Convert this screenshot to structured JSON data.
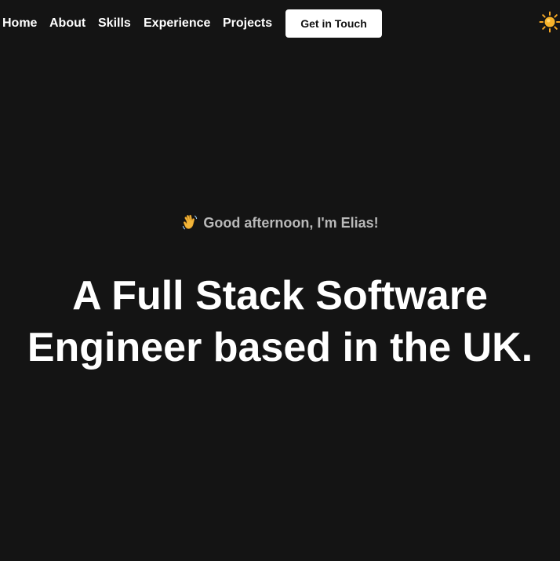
{
  "nav": {
    "links": [
      "Home",
      "About",
      "Skills",
      "Experience",
      "Projects"
    ],
    "cta_label": "Get in Touch",
    "theme_toggle_icon": "sun-icon"
  },
  "hero": {
    "greeting_icon": "waving-hand-icon",
    "greeting": "Good afternoon, I'm Elias!",
    "headline": "A Full Stack Software Engineer based in the UK."
  },
  "colors": {
    "background": "#141414",
    "text_primary": "#ffffff",
    "text_muted": "#b9b9b9",
    "button_bg": "#ffffff",
    "button_text": "#111111",
    "sun": "#f5a623"
  }
}
